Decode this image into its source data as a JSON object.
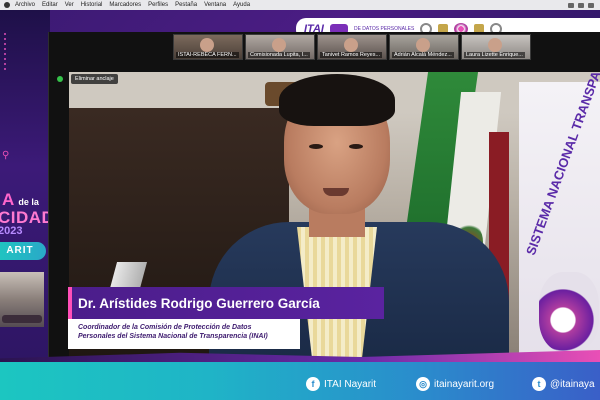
{
  "menubar": {
    "items": [
      "Archivo",
      "Editar",
      "Ver",
      "Historial",
      "Marcadores",
      "Perfiles",
      "Pestaña",
      "Ventana",
      "Ayuda"
    ]
  },
  "header_logos": {
    "brand": "ITAI",
    "subtitle": "DE DATOS PERSONALES"
  },
  "left_panel": {
    "line1": "A",
    "line1_small": "de la",
    "line2": "CIDAD",
    "line3": "2023",
    "pill": "ARIT"
  },
  "zoom": {
    "unpin_label": "Eliminar anclaje",
    "participants": [
      "ISTAI-REBECA FERN...",
      "Comisionada Lupita, I...",
      "Tanivet Ramos Reyes...",
      "Adrián Alcalá Méndez...",
      "Laura Lizette Enrique..."
    ]
  },
  "video_banner": {
    "text": "SISTEMA NACIONAL TRANSPARENCIA"
  },
  "lower_third": {
    "name": "Dr. Arístides Rodrigo Guerrero García",
    "role_line1": "Coordinador de la Comisión de Protección de Datos",
    "role_line2": "Personales del Sistema Nacional de Transparencia (INAI)"
  },
  "footer": {
    "facebook": "ITAI Nayarit",
    "website": "itainayarit.org",
    "twitter": "@itainaya"
  },
  "colors": {
    "purple_dark": "#2a1350",
    "purple_name_bar": "#5a23a0",
    "pink_accent": "#ff4fb8",
    "teal_footer": "#1cc6c1"
  }
}
